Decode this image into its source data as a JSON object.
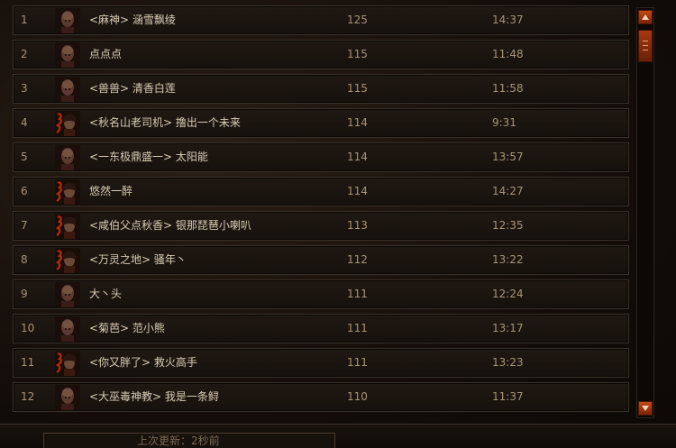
{
  "leaderboard": {
    "rows": [
      {
        "rank": "1",
        "portrait": "male-portrait",
        "name": "<麻神> 涵雪飘绫",
        "level": "125",
        "time": "14:37"
      },
      {
        "rank": "2",
        "portrait": "male-portrait",
        "name": "点点点",
        "level": "115",
        "time": "11:48"
      },
      {
        "rank": "3",
        "portrait": "male-portrait",
        "name": "<兽兽> 清香白莲",
        "level": "115",
        "time": "11:58"
      },
      {
        "rank": "4",
        "portrait": "female-portrait",
        "name": "<秋名山老司机> 撸出一个未来",
        "level": "114",
        "time": "9:31"
      },
      {
        "rank": "5",
        "portrait": "male-portrait",
        "name": "<一东极鼎盛一> 太阳能",
        "level": "114",
        "time": "13:57"
      },
      {
        "rank": "6",
        "portrait": "female-portrait",
        "name": "悠然一醉",
        "level": "114",
        "time": "14:27"
      },
      {
        "rank": "7",
        "portrait": "female-portrait",
        "name": "<咸伯父点秋香> 银那琵琶小喇叭",
        "level": "113",
        "time": "12:35"
      },
      {
        "rank": "8",
        "portrait": "female-portrait",
        "name": "<万灵之地> 骚年丶",
        "level": "112",
        "time": "13:22"
      },
      {
        "rank": "9",
        "portrait": "male-portrait",
        "name": "大丶头",
        "level": "111",
        "time": "12:24"
      },
      {
        "rank": "10",
        "portrait": "male-portrait",
        "name": "<菊芭> 范小熊",
        "level": "111",
        "time": "13:17"
      },
      {
        "rank": "11",
        "portrait": "female-portrait",
        "name": "<你又胖了> 救火高手",
        "level": "111",
        "time": "13:23"
      },
      {
        "rank": "12",
        "portrait": "male-portrait",
        "name": "<大巫毒神教> 我是一条鲟",
        "level": "110",
        "time": "11:37"
      }
    ]
  },
  "scrollbar": {
    "up_icon": "triangle-up-icon",
    "down_icon": "triangle-down-icon"
  },
  "footer": {
    "update_text": "上次更新：2秒前"
  },
  "colors": {
    "accent": "#c44a14",
    "row_text": "#d9cdb4",
    "muted_text": "#a89477"
  }
}
